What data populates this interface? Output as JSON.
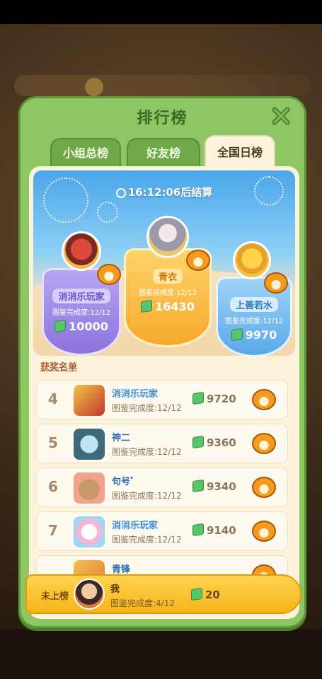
{
  "panel": {
    "title": "排行榜"
  },
  "tabs": [
    {
      "label": "小组总榜"
    },
    {
      "label": "好友榜"
    },
    {
      "label": "全国日榜"
    }
  ],
  "timer": {
    "text": "16:12:06后结算"
  },
  "podium": {
    "first": {
      "name": "青衣",
      "progress": "图鉴完成度:12/12",
      "score": "16430"
    },
    "second": {
      "name": "消消乐玩家",
      "progress": "图鉴完成度:12/12",
      "score": "10000"
    },
    "third": {
      "name": "上善若水",
      "progress": "图鉴完成度:12/12",
      "score": "9970"
    }
  },
  "list": {
    "title": "获奖名单",
    "rows": [
      {
        "rank": "4",
        "name": "消消乐玩家",
        "progress": "图鉴完成度:12/12",
        "score": "9720"
      },
      {
        "rank": "5",
        "name": "神二",
        "progress": "图鉴完成度:12/12",
        "score": "9360"
      },
      {
        "rank": "6",
        "name": "句号゛",
        "progress": "图鉴完成度:12/12",
        "score": "9340"
      },
      {
        "rank": "7",
        "name": "消消乐玩家",
        "progress": "图鉴完成度:12/12",
        "score": "9140"
      },
      {
        "rank": "",
        "name": "青锋",
        "progress": "",
        "score": ""
      }
    ]
  },
  "self": {
    "rank": "未上榜",
    "name": "我",
    "progress": "图鉴完成度:4/12",
    "score": "20"
  },
  "colors": {
    "panel": "#8dc662",
    "accent": "#f4b51a",
    "content": "#fdf3da"
  }
}
